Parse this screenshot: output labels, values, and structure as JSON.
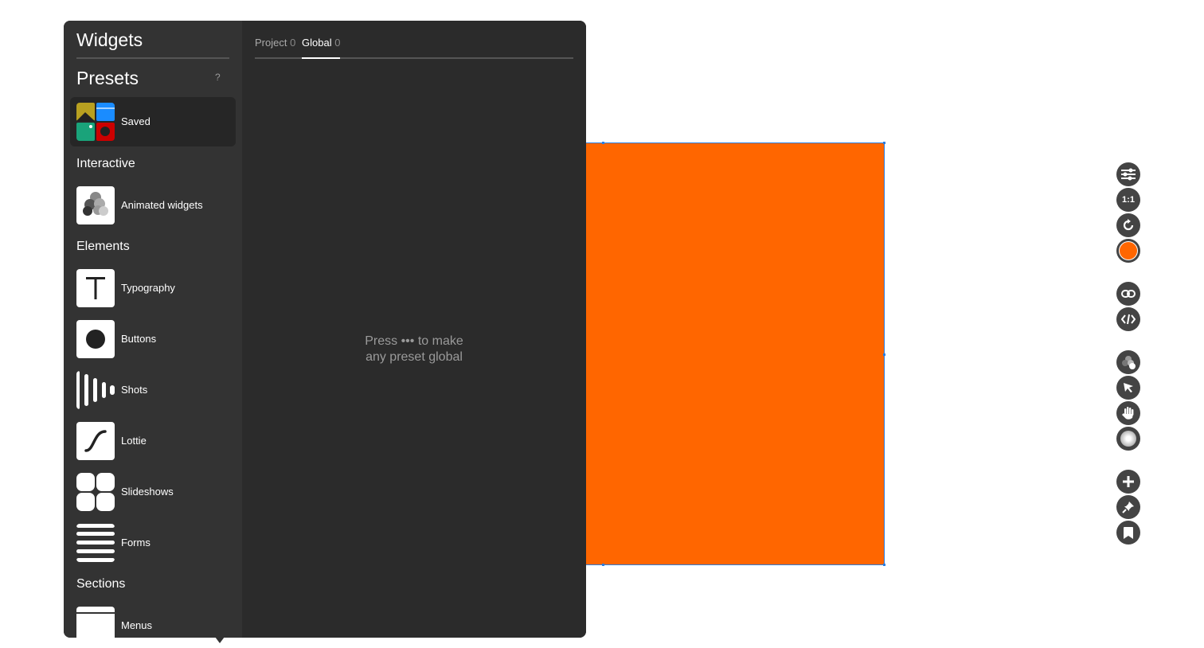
{
  "panel": {
    "title": "Widgets",
    "presets_title": "Presets",
    "help": "?"
  },
  "sidebar": {
    "saved": {
      "label": "Saved"
    },
    "sections": [
      {
        "title": "Interactive"
      },
      {
        "title": "Elements"
      },
      {
        "title": "Sections"
      }
    ],
    "items": [
      {
        "label": "Animated widgets"
      },
      {
        "label": "Typography"
      },
      {
        "label": "Buttons"
      },
      {
        "label": "Shots"
      },
      {
        "label": "Lottie"
      },
      {
        "label": "Slideshows"
      },
      {
        "label": "Forms"
      },
      {
        "label": "Menus"
      }
    ]
  },
  "tabs": [
    {
      "label": "Project",
      "count": "0"
    },
    {
      "label": "Global",
      "count": "0"
    }
  ],
  "empty_state": {
    "line1": "Press ••• to make",
    "line2": "any preset global"
  },
  "toolbar": {
    "icons": [
      "sliders-icon",
      "ratio-icon",
      "rotate-icon",
      "fill-color-icon",
      "link-icon",
      "code-icon",
      "animation-icon",
      "pointer-icon",
      "hand-icon",
      "glow-icon",
      "add-icon",
      "pin-icon",
      "bookmark-icon"
    ],
    "ratio_label": "1:1",
    "fill_color": "#ff6600"
  },
  "canvas": {
    "fill_color": "#ff6600"
  }
}
